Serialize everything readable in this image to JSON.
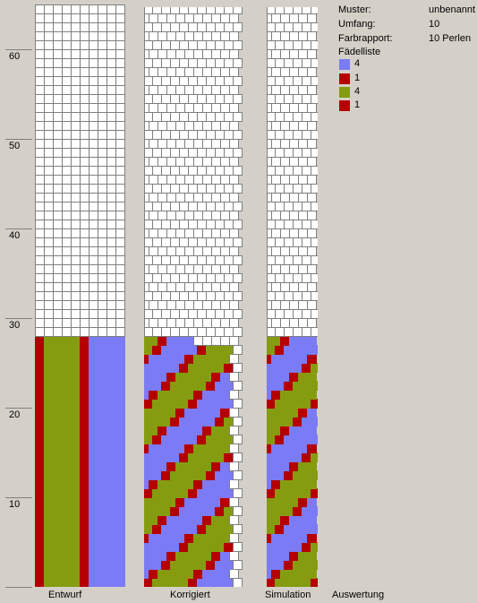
{
  "axis": {
    "labels": [
      "60",
      "50",
      "40",
      "30",
      "20",
      "10"
    ],
    "label_rows": [
      60,
      50,
      40,
      30,
      20,
      10
    ]
  },
  "captions": {
    "entwurf": "Entwurf",
    "korrigiert": "Korrigiert",
    "simulation": "Simulation",
    "auswertung": "Auswertung"
  },
  "info": {
    "muster_label": "Muster:",
    "muster_value": "unbenannt",
    "umfang_label": "Umfang:",
    "umfang_value": "10",
    "farbrapport_label": "Farbrapport:",
    "farbrapport_value": "10 Perlen",
    "faedelliste_label": "Fädelliste"
  },
  "faedelliste": [
    {
      "count": "4",
      "color": "#7b7bf5"
    },
    {
      "count": "1",
      "color": "#b40000"
    },
    {
      "count": "4",
      "color": "#869c10"
    },
    {
      "count": "1",
      "color": "#b40000"
    }
  ],
  "pattern": {
    "circumference": 10,
    "visible_rows": 65,
    "filled_rows": 28,
    "colors": {
      "1": "#b40000",
      "2": "#869c10",
      "3": "#7b7bf5"
    },
    "design_row": [
      1,
      2,
      2,
      2,
      2,
      1,
      3,
      3,
      3,
      3
    ]
  }
}
